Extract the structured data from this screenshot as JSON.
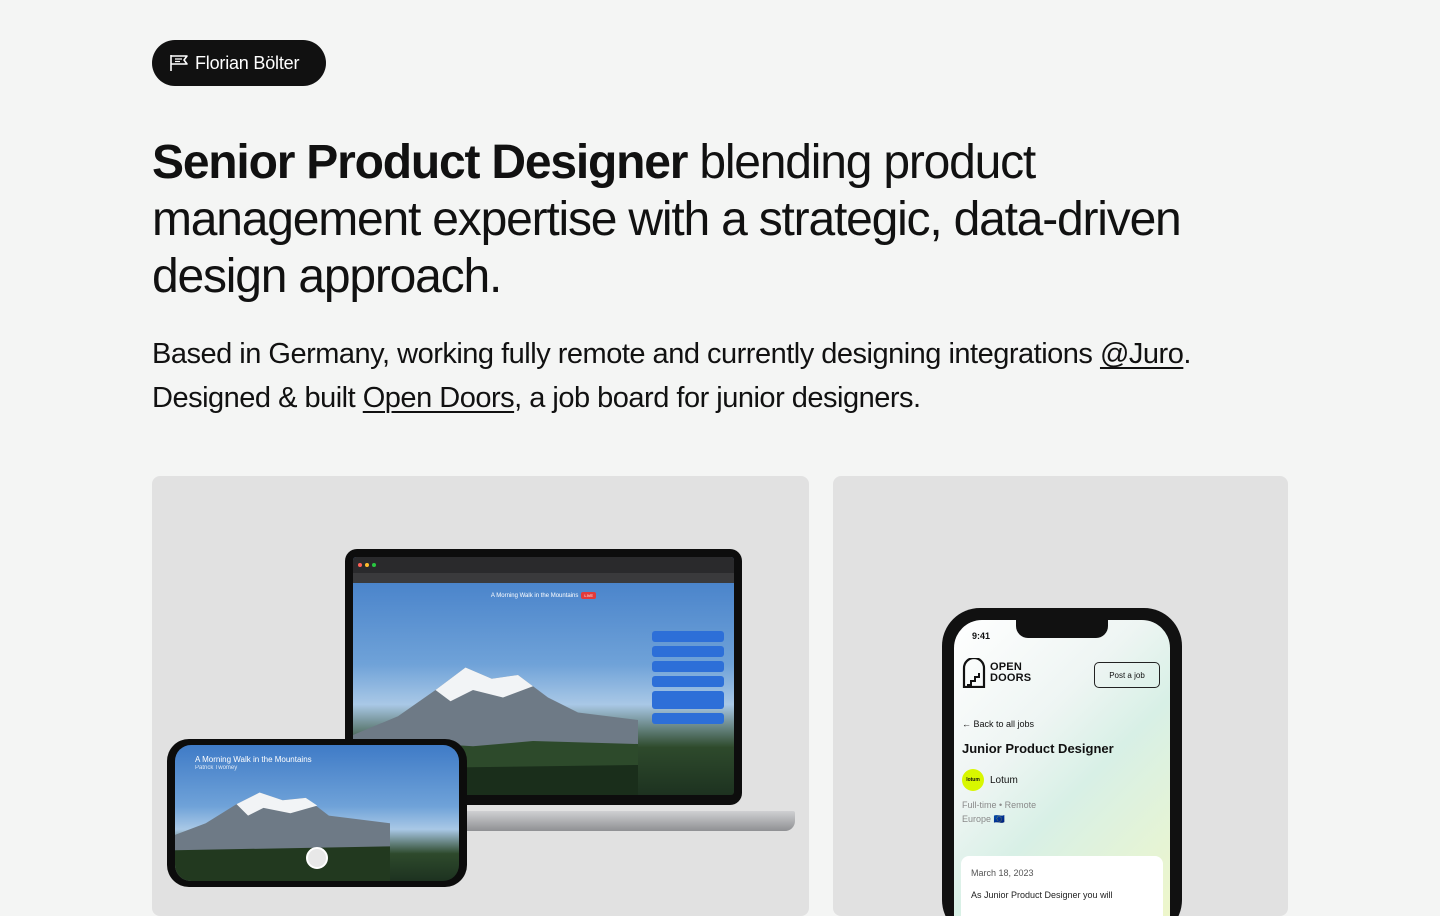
{
  "header": {
    "logo_name": "Florian Bölter"
  },
  "hero": {
    "headline_bold": "Senior Product Designer",
    "headline_rest": " blending product management expertise with a strategic, data-driven design approach."
  },
  "intro": {
    "part1": "Based in Germany, working fully remote and currently designing integrations ",
    "juro_link": "@Juro",
    "part2": ".",
    "part3": "Designed & built ",
    "opendoors_link": "Open Doors",
    "part4": ", a job board for junior designers."
  },
  "projects": [
    {
      "video_title": "A Morning Walk in the Mountains",
      "live_badge": "LIVE",
      "phone_title": "A Morning Walk in the Mountains",
      "phone_subtitle": "Patrick Twomey"
    },
    {
      "status_time": "9:41",
      "logo_line1": "OPEN",
      "logo_line2": "DOORS",
      "post_button": "Post a job",
      "back_link": "Back to all jobs",
      "job_title": "Junior Product Designer",
      "company_logo_text": "lotum",
      "company_name": "Lotum",
      "job_meta": "Full-time • Remote",
      "location": "Europe 🇪🇺",
      "post_date": "March 18, 2023",
      "post_excerpt": "As Junior Product Designer you will"
    }
  ]
}
